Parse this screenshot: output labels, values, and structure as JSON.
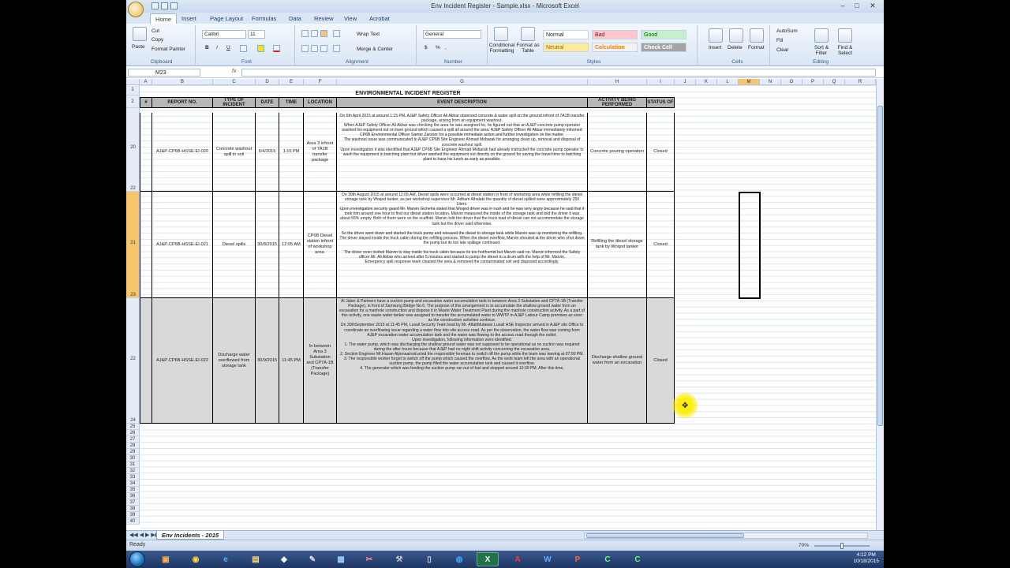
{
  "window": {
    "title": "Env Incident Register - Sample.xlsx - Microsoft Excel",
    "minimize": "–",
    "maximize": "□",
    "close": "✕"
  },
  "tabs": [
    "Home",
    "Insert",
    "Page Layout",
    "Formulas",
    "Data",
    "Review",
    "View",
    "Acrobat"
  ],
  "ribbon": {
    "clipboard": {
      "label": "Clipboard",
      "paste": "Paste",
      "cut": "Cut",
      "copy": "Copy",
      "format_painter": "Format Painter"
    },
    "font": {
      "label": "Font",
      "name": "Calibri",
      "size": "11",
      "bold": "B",
      "italic": "I",
      "underline": "U"
    },
    "alignment": {
      "label": "Alignment",
      "wrap_text": "Wrap Text",
      "merge_center": "Merge & Center"
    },
    "number": {
      "label": "Number",
      "format": "General",
      "currency": "$",
      "percent": "%",
      "comma": ","
    },
    "styles": {
      "label": "Styles",
      "conditional": "Conditional Formatting",
      "format_table": "Format as Table",
      "normal": "Normal",
      "bad": "Bad",
      "good": "Good",
      "neutral": "Neutral",
      "calculation": "Calculation",
      "check_cell": "Check Cell"
    },
    "cells": {
      "label": "Cells",
      "insert": "Insert",
      "delete": "Delete",
      "format": "Format"
    },
    "editing": {
      "label": "Editing",
      "autosum": "AutoSum",
      "fill": "Fill",
      "clear": "Clear",
      "sort_filter": "Sort & Filter",
      "find_select": "Find & Select"
    }
  },
  "formula_bar": {
    "name_box": "M23",
    "fx": "fx",
    "value": ""
  },
  "columns": [
    "A",
    "B",
    "C",
    "D",
    "E",
    "F",
    "G",
    "H",
    "I",
    "J",
    "K",
    "L",
    "M",
    "N",
    "O",
    "P",
    "Q",
    "R"
  ],
  "row_numbers_top": [
    "1",
    "2"
  ],
  "row_numbers_mid": [
    "22",
    "23",
    "24"
  ],
  "row_numbers_bottom": [
    "25",
    "26",
    "27",
    "28",
    "29",
    "30",
    "31",
    "32",
    "33",
    "34",
    "35",
    "36",
    "37",
    "38",
    "39",
    "40"
  ],
  "sheet": {
    "title": "ENVIRONMENTAL INCIDENT REGISTER",
    "headers": [
      "#",
      "REPORT NO.",
      "TYPE OF INCIDENT",
      "DATE",
      "TIME",
      "LOCATION",
      "EVENT DESCRIPTION",
      "ACTIVITY BEING PERFORMED",
      "STATUS OF"
    ],
    "rows": [
      {
        "num": "20",
        "report": "AJ&P-CP6B-HSSE-EI-020",
        "type": "Concrete washout spill in soil",
        "date": "6/4/2015",
        "time": "1:15 PM",
        "location": "Area 3 infront of 7A1B transfer package",
        "description": "On 6th April 2015 at around 1:15 PM, AJ&P Safety Officer Ali Akbar observed concrete & water spill on the ground infront of 7A1B transfer package, arising from an equipment washout.\nWhen AJ&P Safety Officer Ali Akbar was checking the area he was assigned for, he figured out that an AJ&P concrete pump operator washed his equipment out on bare ground which caused a spill all around the area. AJ&P Safety Officer Ali Akbar immediately informed CP6B Environmental Officer Samer Zarzoor for a possible immediate action and further investigation on the matter.\nThe washout issue was communicated to AJ&P CP6B Site Engineer Ahmad Mobarak for arranging clean up, removal and disposal of concrete washout spill.\nUpon investigation it was identified that AJ&P CP6B Site Engineer Ahmad Mobarak had already instructed the concrete pump operator to wash the equipment in batching plant but driver washed the equipment out directly on the ground for saving the travel time to batching plant to have his lunch as early as possible.",
        "activity": "Concrete pouring operation",
        "status": "Closed"
      },
      {
        "num": "21",
        "report": "AJ&P-CP6B-HSSE-EI-021",
        "type": "Diesel spills",
        "date": "30/8/2015",
        "time": "12:05 AM",
        "location": "CP6B Diesel station infront of workshop area.",
        "description": "On 30th August 2015 at around 12:05 AM, Diesel spills were occurred at diesel station in front of workshop area while refilling the diesel storage tank by Woqod tanker, as per workshop supervisor Mr. Adham Alhalabi the quantity of diesel spilled were approximately 250 Liters.\nUpon investigation security guard Mr. Marvin Gicheha stated that Woqod driver was in rush and he was very angry because he said that it took him around one hour to find our diesel station location, Marvin measured the inside of the storage tank and told the driver it was about 55% empty. Both of them were on the scaffold. Marvin told the driver that the truck load of diesel can not accommodate the storage tank but the driver said otherwise.\n\nSo the driver went down and started the truck pump and released the diesel to storage tank while Marvin was up monitoring the refilling. The driver stayed inside the truck cabin during the refilling process. When the diesel overflow, Marvin shouted at the driver who shut down the pump but its too late spillage continued.\n\nThe driver even invited Marvin to stay inside his truck cabin because its too hot/humid but Marvin said no. Marvin informed the Safety officer Mr. Ali Akbar who arrived after 5 minutes and started to pump the diesel to a drum with the help of Mr. Marvin.\nEmergency spill response team cleaned the area & removed the contaminated soil and disposed accordingly.",
        "activity": "Refilling the diesel storage tank by Woqod tanker",
        "status": "Closed"
      },
      {
        "num": "22",
        "report": "AJ&P-CP6B-HSSE-EI-022",
        "type": "Discharge water overflowed from storage tank",
        "date": "30/9/2015",
        "time": "11:45 PM",
        "location": "In between Area 3 Substation and CP7A-1B (Transfer Package)",
        "description": "Al Jaber & Partners have a suction pump and excavation water accumulation tank in between Area 3 Substation and CP7A-1B (Transfer Package), in front of Samsung Bridge No.6. The purpose of this arrangement is to accumulate the shallow ground water from an excavation for a manhole construction and dispose it in Waste Water Treatment Plant during the manhole construction activity. As a part of this activity, one waste water tanker was assigned to transfer the accumulated water to WWTP in AJ&P Labour Camp premises as soon as the construction activities continue.\nOn 30thSeptember 2015 at 11:45 PM, Lusail Security Team lead by Mr. AftabMutawar Lusail HSE Inspector arrived in AJ&P site Office to coordinate an overflowing issue regarding a water flow into site access road. As per the observation, the water flow was coming from AJ&P excavation water accumulation tank and the water was flowing to the access road through the outlet.\nUpon investigation, following information were identified:\n1. The water pump, which was discharging the shallow ground water was not supposed to be operational as no suction was required during the after hours because that AJ&P had no night shift activity concerning the excavation area.\n2. Section Engineer Mr.Hasan Aljomaainstructed the responsible foreman to switch off the pump while the team was leaving at 07:00 PM.\n3. The responsible worker forgot to switch off the pump which caused the overflow. As the work team left the area with an operational suction pump, the pump filled the water accumulation tank and caused it overflow.\n4. The generator which was feeding the suction pump ran out of fuel and stopped around 10:30 PM. After this time,",
        "activity": "Discharge shallow ground water from an excavation",
        "status": "Closed"
      }
    ]
  },
  "sheet_tab": "Env Incidents - 2015",
  "status": {
    "ready": "Ready",
    "zoom": "70%"
  },
  "taskbar": {
    "time": "4:12 PM",
    "date": "10/18/2015"
  }
}
